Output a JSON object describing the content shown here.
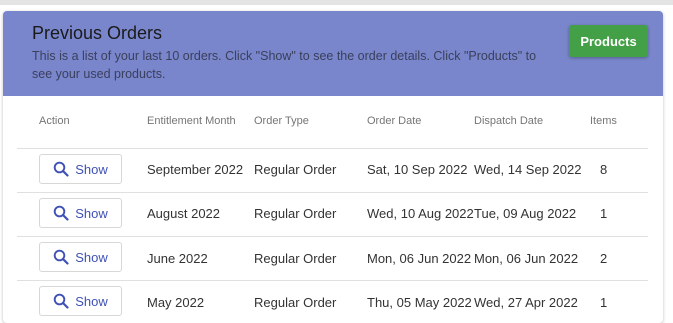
{
  "header": {
    "title": "Previous Orders",
    "description": "This is a list of your last 10 orders. Click \"Show\" to see the order details. Click \"Products\" to see your used products.",
    "products_label": "Products"
  },
  "table": {
    "columns": [
      "Action",
      "Entitlement Month",
      "Order Type",
      "Order Date",
      "Dispatch Date",
      "Items"
    ],
    "rows": [
      {
        "action": "Show",
        "month": "September 2022",
        "type": "Regular Order",
        "order_date": "Sat, 10 Sep 2022",
        "dispatch_date": "Wed, 14 Sep 2022",
        "items": "8"
      },
      {
        "action": "Show",
        "month": "August 2022",
        "type": "Regular Order",
        "order_date": "Wed, 10 Aug 2022",
        "dispatch_date": "Tue, 09 Aug 2022",
        "items": "1"
      },
      {
        "action": "Show",
        "month": "June 2022",
        "type": "Regular Order",
        "order_date": "Mon, 06 Jun 2022",
        "dispatch_date": "Mon, 06 Jun 2022",
        "items": "2"
      },
      {
        "action": "Show",
        "month": "May 2022",
        "type": "Regular Order",
        "order_date": "Thu, 05 May 2022",
        "dispatch_date": "Wed, 27 Apr 2022",
        "items": "1"
      }
    ]
  },
  "icons": {
    "show": "search-icon"
  },
  "colors": {
    "header_bg": "#7986cb",
    "products_button": "#43a047",
    "link_blue": "#3f51b5"
  }
}
